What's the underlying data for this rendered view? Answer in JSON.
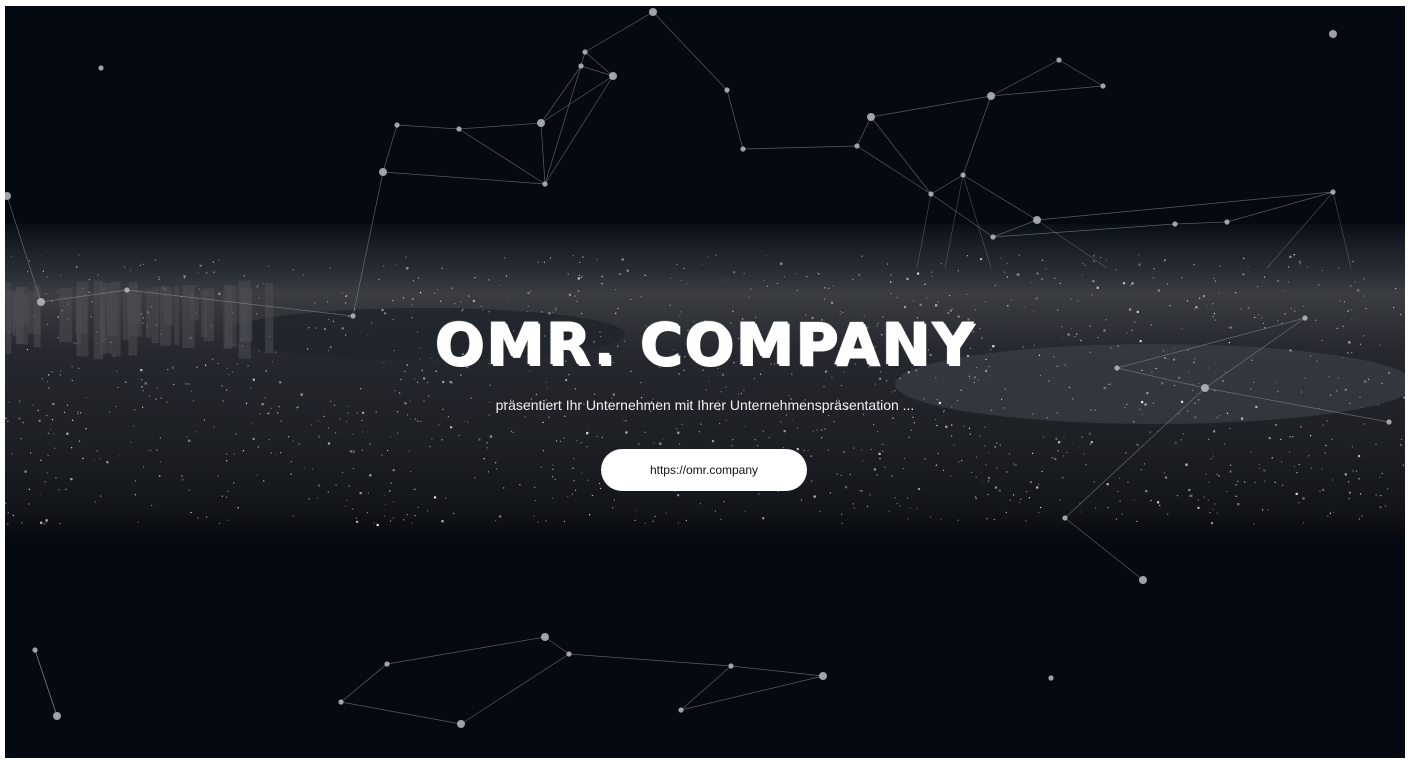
{
  "hero": {
    "title": "OMR. COMPANY",
    "subtitle": "präsentiert Ihr Unternehmen mit Ihrer Unternehmenspräsentation ..."
  },
  "cta": {
    "label": "https://omr.company"
  },
  "colors": {
    "background": "#050a12",
    "text": "#ffffff",
    "button_bg": "#ffffff",
    "button_text": "#111111"
  }
}
